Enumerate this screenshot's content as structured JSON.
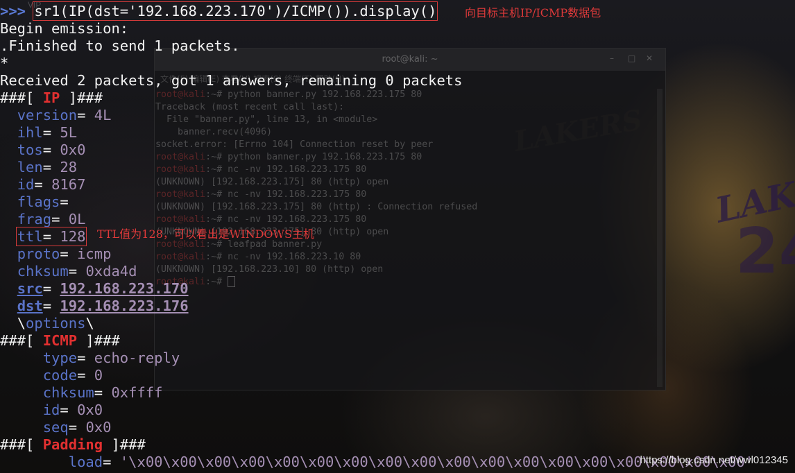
{
  "background": {
    "corner_text": "VIP",
    "jersey_text": "LAKERS",
    "jersey_number": "24"
  },
  "bg_terminal": {
    "title": "root@kali: ~",
    "controls": [
      "–",
      "□",
      "✕"
    ],
    "menu": "文件(F)  编辑(E)  查看(V)  搜索(S)  终端(T)  帮助(H)",
    "lines": [
      {
        "user": "root@kali",
        "rest": ":~# python banner.py 192.168.223.175 80"
      },
      {
        "user": "",
        "rest": "Traceback (most recent call last):"
      },
      {
        "user": "",
        "rest": "  File \"banner.py\", line 13, in <module>"
      },
      {
        "user": "",
        "rest": "    banner.recv(4096)"
      },
      {
        "user": "",
        "rest": "socket.error: [Errno 104] Connection reset by peer"
      },
      {
        "user": "root@kali",
        "rest": ":~# python banner.py 192.168.223.175 80"
      },
      {
        "user": "root@kali",
        "rest": ":~# nc -nv 192.168.223.175 80"
      },
      {
        "user": "",
        "rest": "(UNKNOWN) [192.168.223.175] 80 (http) open"
      },
      {
        "user": "root@kali",
        "rest": ":~# nc -nv 192.168.223.175 80"
      },
      {
        "user": "",
        "rest": "(UNKNOWN) [192.168.223.175] 80 (http) : Connection refused"
      },
      {
        "user": "root@kali",
        "rest": ":~# nc -nv 192.168.223.175 80"
      },
      {
        "user": "",
        "rest": "(UNKNOWN) [192.168.223.175] 80 (http) open"
      },
      {
        "user": "root@kali",
        "rest": ":~# leafpad banner.py"
      },
      {
        "user": "root@kali",
        "rest": ":~# nc -nv 192.168.223.10 80"
      },
      {
        "user": "",
        "rest": "(UNKNOWN) [192.168.223.10] 80 (http) open"
      },
      {
        "user": "root@kali",
        "rest": ":~# "
      }
    ]
  },
  "terminal": {
    "prompt": ">>> ",
    "command": "sr1(IP(dst='192.168.223.170')/ICMP()).display()",
    "begin": "Begin emission:",
    "finished": ".Finished to send 1 packets.",
    "star": "*",
    "received": "Received 2 packets, got 1 answers, remaining 0 packets",
    "ip_header": {
      "pre": "###[ ",
      "name": "IP",
      "post": " ]###"
    },
    "ip_fields": {
      "version": {
        "k": "version",
        "v": "4L"
      },
      "ihl": {
        "k": "ihl",
        "v": "5L"
      },
      "tos": {
        "k": "tos",
        "v": "0x0"
      },
      "len": {
        "k": "len",
        "v": "28"
      },
      "id": {
        "k": "id",
        "v": "8167"
      },
      "flags": {
        "k": "flags",
        "v": ""
      },
      "frag": {
        "k": "frag",
        "v": "0L"
      },
      "ttl": {
        "k": "ttl",
        "v": "128"
      },
      "proto": {
        "k": "proto",
        "v": "icmp"
      },
      "chksum": {
        "k": "chksum",
        "v": "0xda4d"
      },
      "src": {
        "k": "src",
        "v": "192.168.223.170"
      },
      "dst": {
        "k": "dst",
        "v": "192.168.223.176"
      }
    },
    "options": {
      "pre": "\\",
      "name": "options",
      "post": "\\"
    },
    "icmp_header": {
      "pre": "###[ ",
      "name": "ICMP",
      "post": " ]###"
    },
    "icmp_fields": {
      "type": {
        "k": "type",
        "v": "echo-reply"
      },
      "code": {
        "k": "code",
        "v": "0"
      },
      "chksum": {
        "k": "chksum",
        "v": "0xffff"
      },
      "id": {
        "k": "id",
        "v": "0x0"
      },
      "seq": {
        "k": "seq",
        "v": "0x0"
      }
    },
    "padding_header": {
      "pre": "###[ ",
      "name": "Padding",
      "post": " ]###"
    },
    "load": {
      "k": "load",
      "v": "'\\x00\\x00\\x00\\x00\\x00\\x00\\x00\\x00\\x00\\x00\\x00\\x00\\x00\\x00\\x00\\x00\\x00\\x00'"
    },
    "eq": "= "
  },
  "annotations": {
    "command_note": "向目标主机IP/ICMP数据包",
    "ttl_note": "TTL值为128，可以看出是WINDOWS主机"
  },
  "watermark": "https://blog.csdn.net/wwl012345"
}
